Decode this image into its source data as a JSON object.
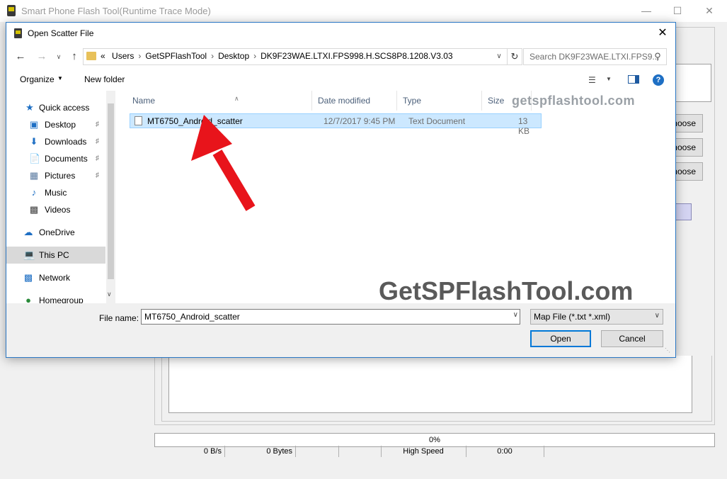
{
  "app": {
    "title": "Smart Phone Flash Tool(Runtime Trace Mode)",
    "choose_label": "noose",
    "progress": "0%",
    "status": {
      "speed": "0 B/s",
      "bytes": "0 Bytes",
      "mode": "High Speed",
      "time": "0:00"
    }
  },
  "dialog": {
    "title": "Open Scatter File",
    "address": {
      "breadcrumb": [
        "«",
        "Users",
        "GetSPFlashTool",
        "Desktop",
        "DK9F23WAE.LTXI.FPS998.H.SCS8P8.1208.V3.03"
      ]
    },
    "search": {
      "placeholder": "Search DK9F23WAE.LTXI.FPS9..."
    },
    "toolbar": {
      "organize": "Organize",
      "new_folder": "New folder"
    },
    "nav": {
      "items": [
        {
          "label": "Quick access",
          "icon": "star-icon"
        },
        {
          "label": "Desktop",
          "icon": "desktop-icon",
          "pinned": true
        },
        {
          "label": "Downloads",
          "icon": "download-icon",
          "pinned": true
        },
        {
          "label": "Documents",
          "icon": "documents-icon",
          "pinned": true
        },
        {
          "label": "Pictures",
          "icon": "pictures-icon",
          "pinned": true
        },
        {
          "label": "Music",
          "icon": "music-icon"
        },
        {
          "label": "Videos",
          "icon": "videos-icon"
        },
        {
          "label": "OneDrive",
          "icon": "cloud-icon"
        },
        {
          "label": "This PC",
          "icon": "computer-icon",
          "selected": true
        },
        {
          "label": "Network",
          "icon": "network-icon"
        },
        {
          "label": "Homegroup",
          "icon": "homegroup-icon"
        }
      ]
    },
    "columns": {
      "name": "Name",
      "date": "Date modified",
      "type": "Type",
      "size": "Size"
    },
    "files": [
      {
        "name": "MT6750_Android_scatter",
        "date": "12/7/2017 9:45 PM",
        "type": "Text Document",
        "size": "13 KB"
      }
    ],
    "watermarks": {
      "top": "getspflashtool.com",
      "main": "GetSPFlashTool.com"
    },
    "filename": {
      "label": "File name:",
      "value": "MT6750_Android_scatter"
    },
    "filetype": {
      "value": "Map File (*.txt *.xml)"
    },
    "buttons": {
      "open": "Open",
      "cancel": "Cancel"
    },
    "colors": {
      "selection": "#cce8ff",
      "accent": "#0078d7",
      "arrow": "#e8141b"
    }
  }
}
